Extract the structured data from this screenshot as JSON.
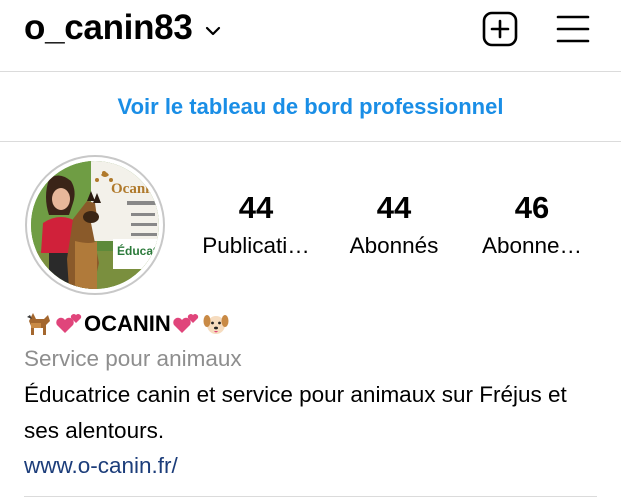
{
  "header": {
    "username": "o_canin83",
    "chevron_icon": "chevron-down-icon",
    "new_post_icon": "plus-square-icon",
    "menu_icon": "hamburger-menu-icon"
  },
  "professional_dashboard": {
    "label": "Voir le tableau de bord professionnel",
    "color": "#1a8ee6"
  },
  "profile": {
    "avatar_logo_text": "Ocanin",
    "avatar_sign_text": "Éducat",
    "stats": [
      {
        "value": "44",
        "label": "Publicati…"
      },
      {
        "value": "44",
        "label": "Abonnés"
      },
      {
        "value": "46",
        "label": "Abonne…"
      }
    ],
    "display_name": "OCANIN",
    "name_emojis": [
      "dog-icon",
      "two-hearts-icon",
      "two-hearts-icon",
      "dog-face-icon"
    ],
    "category": "Service pour animaux",
    "bio": "Éducatrice canin et service pour animaux sur Fréjus et ses alentours.",
    "website": "www.o-canin.fr/"
  },
  "colors": {
    "accent_blue": "#1a8ee6",
    "category_gray": "#8e8e8e",
    "link_navy": "#1c3d7a",
    "heart_pink": "#e0457b"
  }
}
